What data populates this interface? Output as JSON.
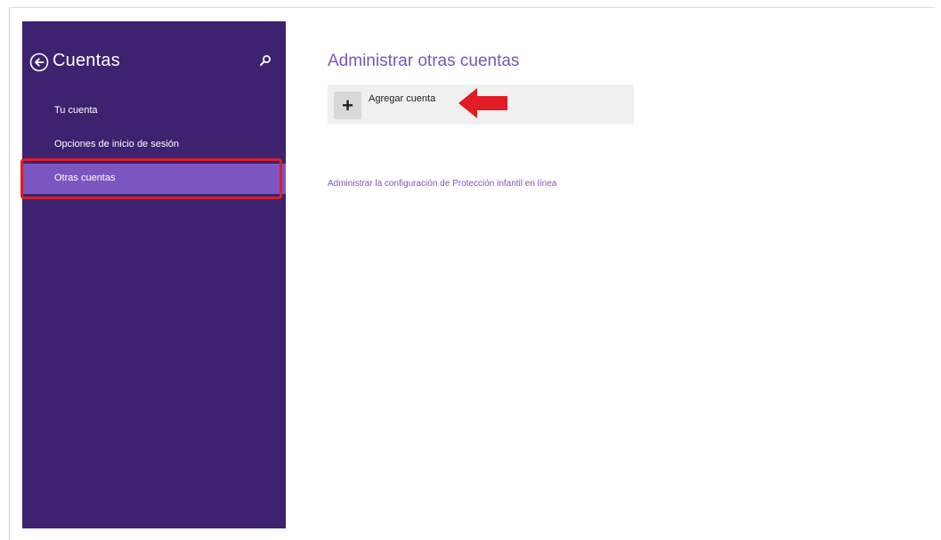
{
  "sidebar": {
    "title": "Cuentas",
    "back_icon": "back-arrow-circle-icon",
    "search_icon": "search-icon",
    "background": "#3c226f",
    "selected_background": "#7b55c0",
    "items": [
      {
        "label": "Tu cuenta",
        "selected": false
      },
      {
        "label": "Opciones de inicio de sesión",
        "selected": false
      },
      {
        "label": "Otras cuentas",
        "selected": true
      }
    ]
  },
  "main": {
    "title": "Administrar otras cuentas",
    "add_account": {
      "icon": "plus-icon",
      "label": "Agregar cuenta"
    },
    "family_link": "Administrar la configuración de Protección infantil en línea",
    "accent_color": "#7b55c0"
  },
  "annotations": {
    "highlight_color": "#e01c24",
    "arrow_icon": "red-arrow-pointing-left"
  }
}
